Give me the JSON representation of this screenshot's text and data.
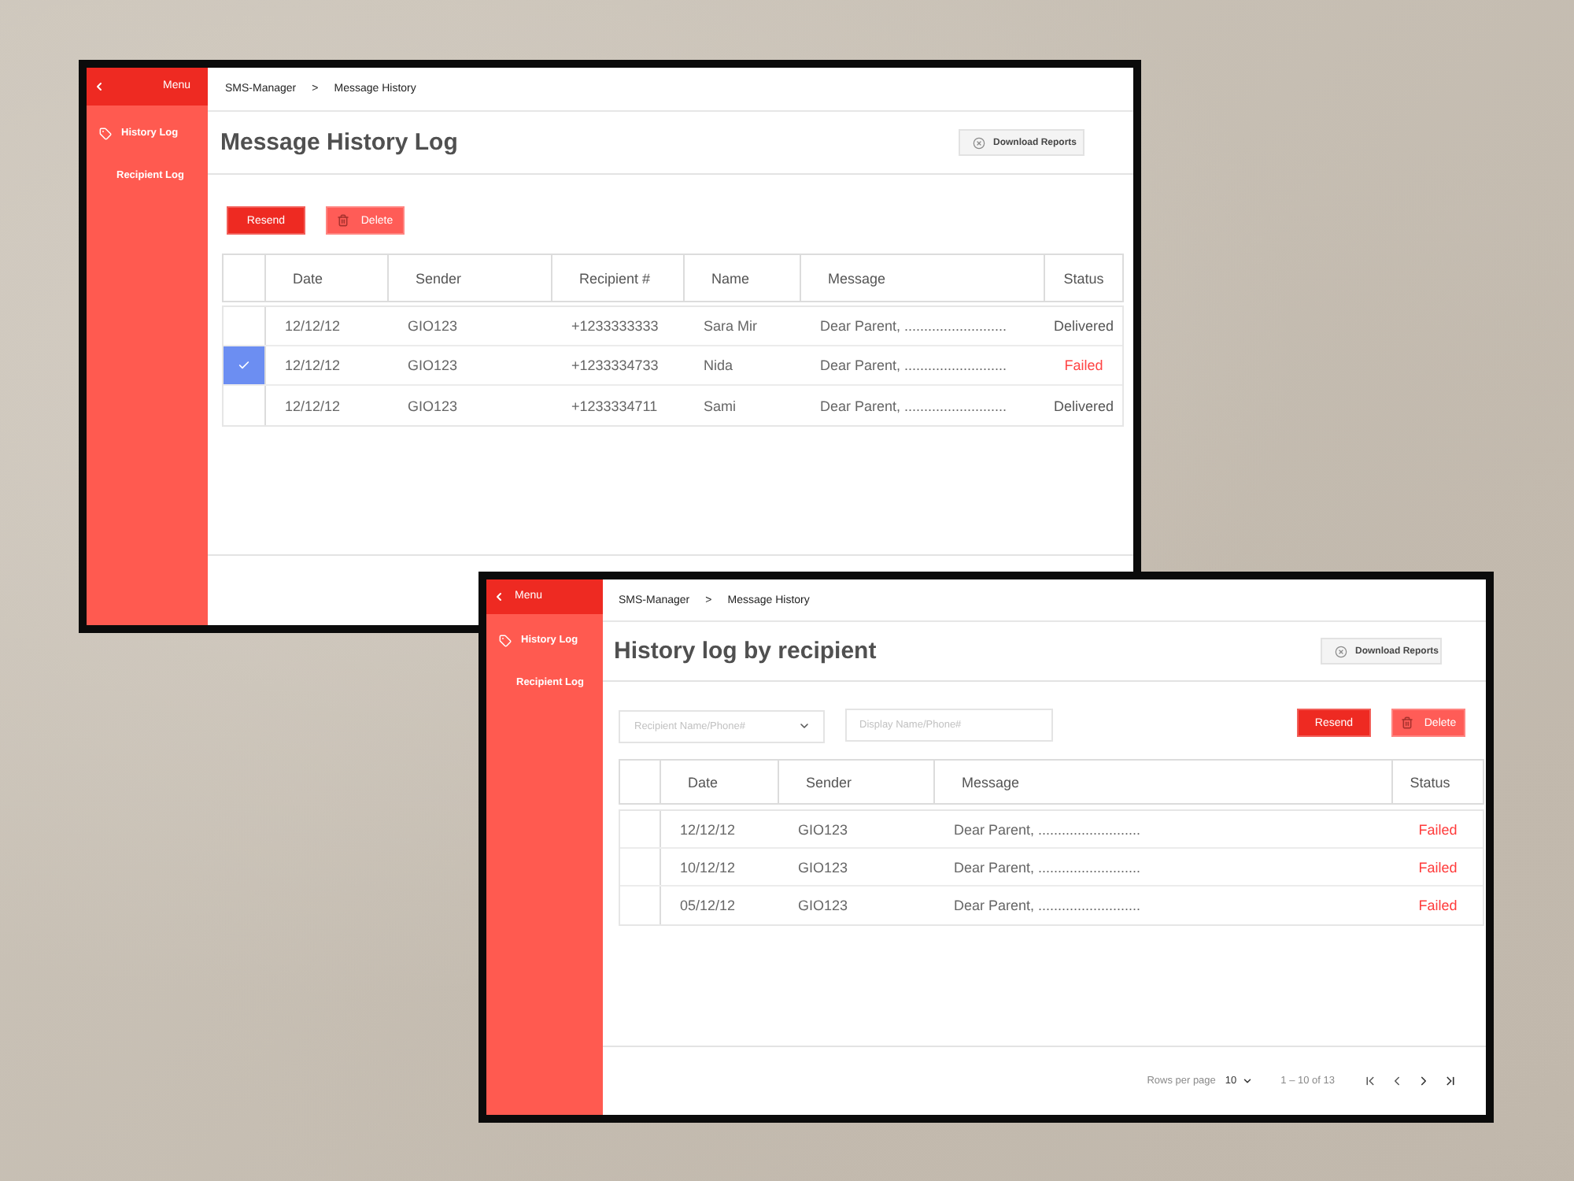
{
  "windows": [
    {
      "kind": "history",
      "sidebar": {
        "title": "Menu",
        "items": [
          {
            "kind": "icon",
            "label": "History Log"
          },
          {
            "kind": "text",
            "label": "Recipient Log"
          }
        ]
      },
      "breadcrumb": {
        "items": [
          "SMS-Manager",
          "Message History"
        ],
        "separator": ">"
      },
      "title": "Message History Log",
      "download_button": "Download Reports",
      "actions": [
        {
          "kind": "primary",
          "label": "Resend"
        },
        {
          "kind": "danger",
          "label": "Delete"
        }
      ],
      "table": {
        "columns": [
          "Date",
          "Sender",
          "Recipient #",
          "Name",
          "Message",
          "Status"
        ],
        "rows": [
          {
            "selected": false,
            "color": "#555555",
            "cells": [
              "12/12/12",
              "GIO123",
              "+1233333333",
              "Sara Mir",
              "Dear Parent, ..........................",
              "Delivered"
            ]
          },
          {
            "selected": true,
            "color": "#ff4545",
            "cells": [
              "12/12/12",
              "GIO123",
              "+1233334733",
              "Nida",
              "Dear Parent, ..........................",
              "Failed"
            ]
          },
          {
            "selected": false,
            "color": "#555555",
            "cells": [
              "12/12/12",
              "GIO123",
              "+1233334711",
              "Sami",
              "Dear Parent, ..........................",
              "Delivered"
            ]
          }
        ]
      }
    },
    {
      "kind": "recipient",
      "sidebar": {
        "title": "Menu",
        "items": [
          {
            "kind": "icon",
            "label": "History Log"
          },
          {
            "kind": "text",
            "label": "Recipient Log"
          }
        ]
      },
      "breadcrumb": {
        "items": [
          "SMS-Manager",
          "Message History"
        ],
        "separator": ">"
      },
      "title": "History log by recipient",
      "download_button": "Download Reports",
      "filters": [
        {
          "kind": "select",
          "placeholder": "Recipient Name/Phone#"
        },
        {
          "kind": "input",
          "placeholder": "Display Name/Phone#"
        }
      ],
      "actions": [
        {
          "kind": "primary",
          "label": "Resend"
        },
        {
          "kind": "danger",
          "label": "Delete"
        }
      ],
      "table": {
        "columns": [
          "Date",
          "Sender",
          "Message",
          "Status"
        ],
        "rows": [
          {
            "selected": false,
            "color": "#ff3b3b",
            "cells": [
              "12/12/12",
              "GIO123",
              "Dear Parent, ..........................",
              "Failed"
            ]
          },
          {
            "selected": false,
            "color": "#ff3b3b",
            "cells": [
              "10/12/12",
              "GIO123",
              "Dear Parent, ..........................",
              "Failed"
            ]
          },
          {
            "selected": false,
            "color": "#ff3b3b",
            "cells": [
              "05/12/12",
              "GIO123",
              "Dear Parent, ..........................",
              "Failed"
            ]
          }
        ]
      },
      "pagination": {
        "rows_per_page_label": "Rows per page",
        "rows_per_page": "10",
        "range": "1 – 10 of 13"
      }
    }
  ]
}
